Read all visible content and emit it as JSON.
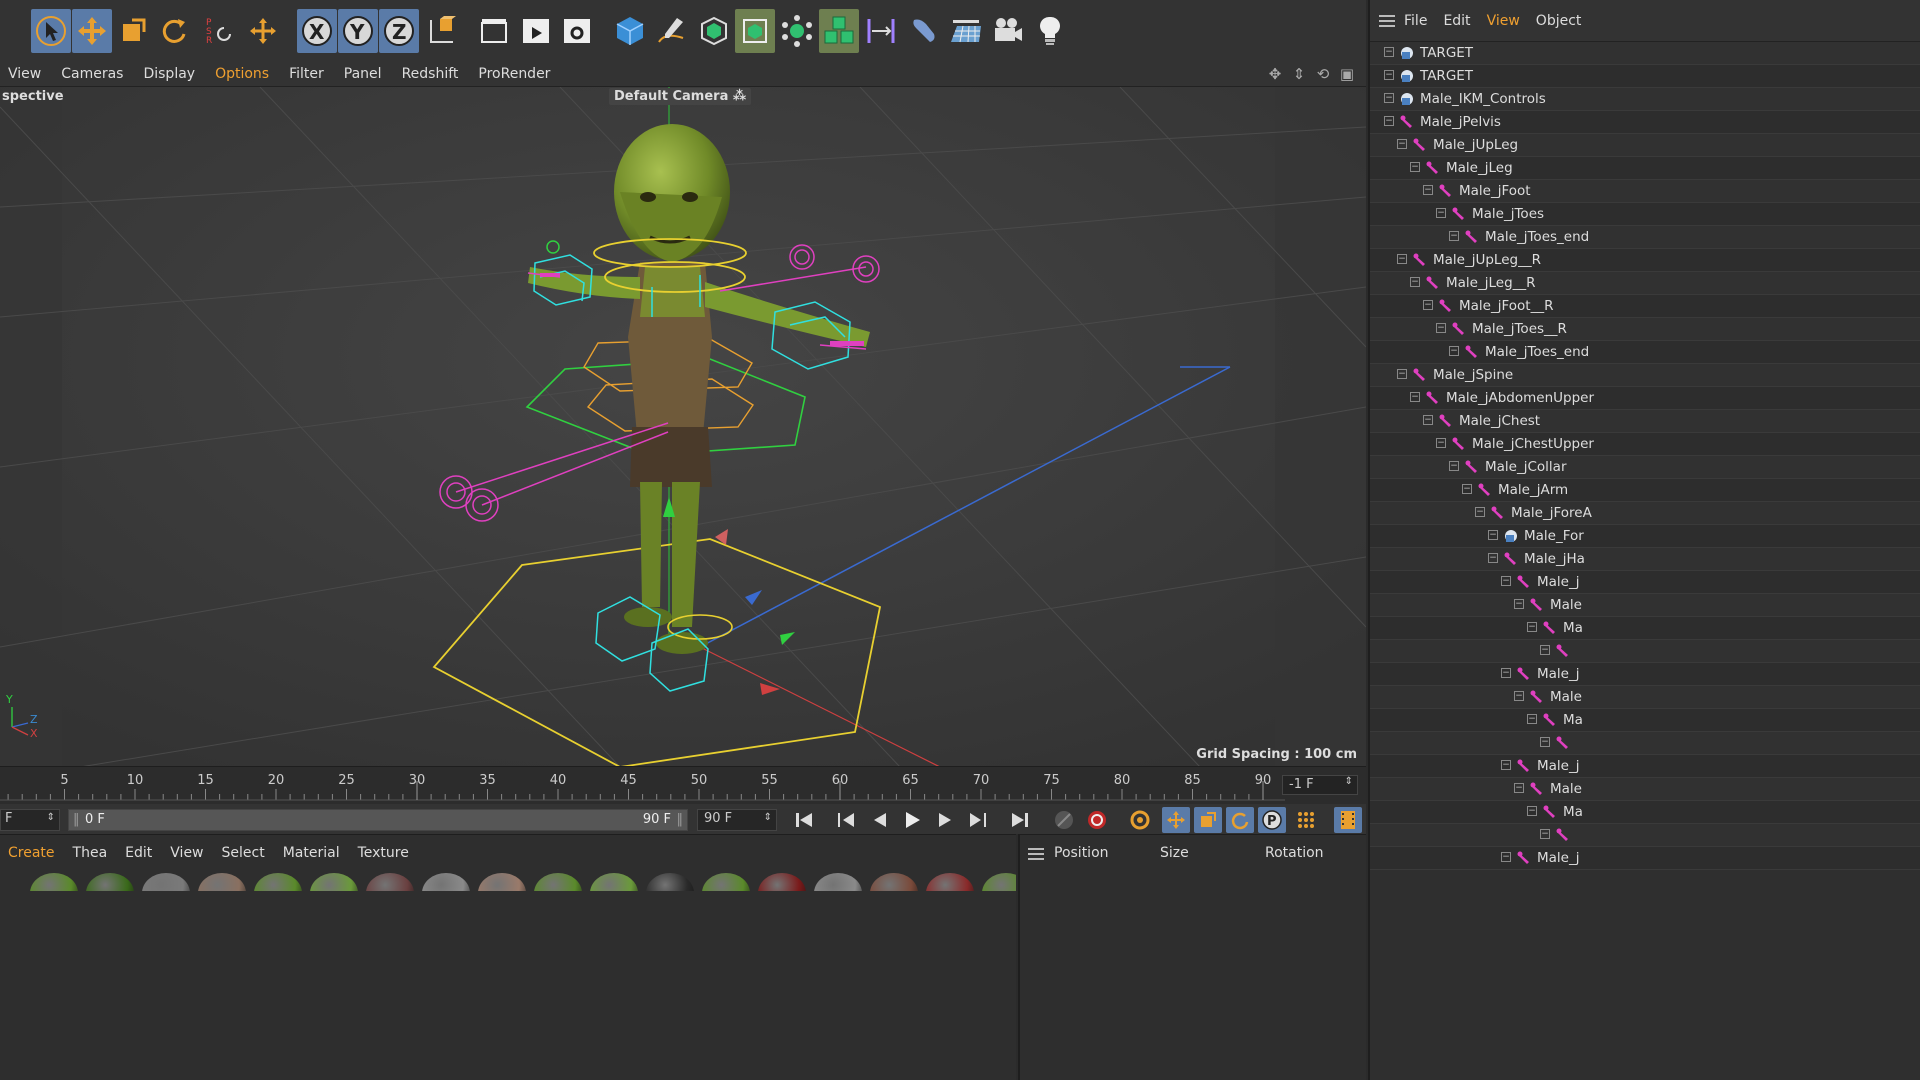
{
  "toolbar": {
    "icons": [
      "select-tool-icon",
      "move-tool-icon",
      "scale-tool-icon",
      "rotate-tool-icon",
      "psr-tool-icon",
      "transform-tool-icon",
      "x-axis-lock-icon",
      "y-axis-lock-icon",
      "z-axis-lock-icon",
      "coordinate-system-icon",
      "render-region-icon",
      "render-view-icon",
      "render-settings-icon",
      "cube-primitive-icon",
      "pen-spline-icon",
      "subdivision-icon",
      "generator-icon",
      "deformer-icon",
      "cloner-icon",
      "field-icon",
      "deformer-bend-icon",
      "floor-icon",
      "camera-icon",
      "light-icon"
    ]
  },
  "viewport_menu": {
    "items": [
      "View",
      "Cameras",
      "Display",
      "Options",
      "Filter",
      "Panel",
      "Redshift",
      "ProRender"
    ],
    "highlighted": "Options"
  },
  "viewport": {
    "view_label": "spective",
    "camera_label": "Default Camera",
    "grid_spacing": "Grid Spacing : 100 cm",
    "axis_y": "Y",
    "axis_z": "Z",
    "axis_x": "X"
  },
  "object_manager": {
    "menu": [
      "File",
      "Edit",
      "View",
      "Object"
    ],
    "highlighted": "View",
    "rows": [
      {
        "name": "TARGET",
        "indent": 0,
        "type": "null"
      },
      {
        "name": "TARGET",
        "indent": 0,
        "type": "null"
      },
      {
        "name": "Male_IKM_Controls",
        "indent": 0,
        "type": "null"
      },
      {
        "name": "Male_jPelvis",
        "indent": 0,
        "type": "joint"
      },
      {
        "name": "Male_jUpLeg",
        "indent": 1,
        "type": "joint"
      },
      {
        "name": "Male_jLeg",
        "indent": 2,
        "type": "joint"
      },
      {
        "name": "Male_jFoot",
        "indent": 3,
        "type": "joint"
      },
      {
        "name": "Male_jToes",
        "indent": 4,
        "type": "joint"
      },
      {
        "name": "Male_jToes_end",
        "indent": 5,
        "type": "joint"
      },
      {
        "name": "Male_jUpLeg__R",
        "indent": 1,
        "type": "joint"
      },
      {
        "name": "Male_jLeg__R",
        "indent": 2,
        "type": "joint"
      },
      {
        "name": "Male_jFoot__R",
        "indent": 3,
        "type": "joint"
      },
      {
        "name": "Male_jToes__R",
        "indent": 4,
        "type": "joint"
      },
      {
        "name": "Male_jToes_end",
        "indent": 5,
        "type": "joint"
      },
      {
        "name": "Male_jSpine",
        "indent": 1,
        "type": "joint"
      },
      {
        "name": "Male_jAbdomenUpper",
        "indent": 2,
        "type": "joint"
      },
      {
        "name": "Male_jChest",
        "indent": 3,
        "type": "joint"
      },
      {
        "name": "Male_jChestUpper",
        "indent": 4,
        "type": "joint"
      },
      {
        "name": "Male_jCollar",
        "indent": 5,
        "type": "joint"
      },
      {
        "name": "Male_jArm",
        "indent": 6,
        "type": "joint"
      },
      {
        "name": "Male_jForeA",
        "indent": 7,
        "type": "joint"
      },
      {
        "name": "Male_For",
        "indent": 8,
        "type": "null"
      },
      {
        "name": "Male_jHa",
        "indent": 8,
        "type": "joint"
      },
      {
        "name": "Male_j",
        "indent": 9,
        "type": "joint"
      },
      {
        "name": "Male",
        "indent": 10,
        "type": "joint"
      },
      {
        "name": "Ma",
        "indent": 11,
        "type": "joint"
      },
      {
        "name": "",
        "indent": 12,
        "type": "joint"
      },
      {
        "name": "Male_j",
        "indent": 9,
        "type": "joint"
      },
      {
        "name": "Male",
        "indent": 10,
        "type": "joint"
      },
      {
        "name": "Ma",
        "indent": 11,
        "type": "joint"
      },
      {
        "name": "",
        "indent": 12,
        "type": "joint"
      },
      {
        "name": "Male_j",
        "indent": 9,
        "type": "joint"
      },
      {
        "name": "Male",
        "indent": 10,
        "type": "joint"
      },
      {
        "name": "Ma",
        "indent": 11,
        "type": "joint"
      },
      {
        "name": "",
        "indent": 12,
        "type": "joint"
      },
      {
        "name": "Male_j",
        "indent": 9,
        "type": "joint"
      }
    ]
  },
  "timeline": {
    "ticks": [
      "5",
      "10",
      "15",
      "20",
      "25",
      "30",
      "35",
      "40",
      "45",
      "50",
      "55",
      "60",
      "65",
      "70",
      "75",
      "80",
      "85",
      "90"
    ],
    "current_frame": "-1 F"
  },
  "transport": {
    "start_field": "F",
    "range_start": "0 F",
    "range_end": "90 F",
    "end_field": "90 F"
  },
  "material_manager": {
    "menu": [
      "Create",
      "Thea",
      "Edit",
      "View",
      "Select",
      "Material",
      "Texture"
    ],
    "highlighted": "Create",
    "swatch_colors": [
      "#5a8a2a",
      "#3a6a1a",
      "#7a7a7a",
      "#8a7060",
      "#5a8a2a",
      "#6a9a3a",
      "#6a4040",
      "#8a8a8a",
      "#9a7a6a",
      "#5a8a2a",
      "#6a9a3a",
      "#2a2a2a",
      "#5a8a2a",
      "#7a1a1a",
      "#8a8a8a",
      "#7a4a3a",
      "#8a2a2a",
      "#5a8a2a",
      "#4a3a3a"
    ]
  },
  "coordinates": {
    "position_label": "Position",
    "size_label": "Size",
    "rotation_label": "Rotation"
  },
  "colors": {
    "accent": "#f0a030",
    "active_tool": "#5a7ba8",
    "joint_magenta": "#e040c0",
    "rig_cyan": "#30e0e0",
    "rig_yellow": "#e8d030",
    "rig_green": "#30d040",
    "rig_orange": "#e8a030"
  }
}
